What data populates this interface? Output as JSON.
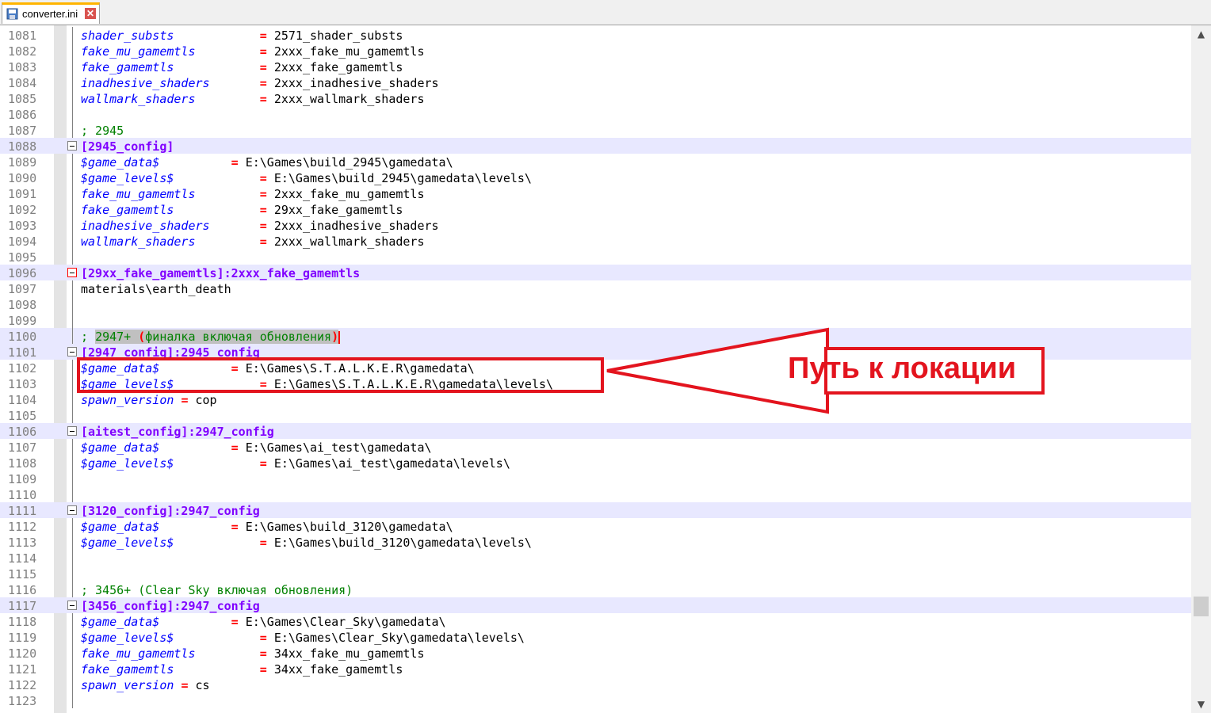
{
  "tab": {
    "title": "converter.ini",
    "icon": "save-icon",
    "close_icon": "close-icon"
  },
  "callout": {
    "text": "Путь к локации",
    "color": "#e3141e"
  },
  "lines": [
    {
      "n": "1081",
      "parts": [
        [
          "k",
          "shader_substs"
        ],
        [
          "p",
          "            "
        ],
        [
          "eq",
          "="
        ],
        [
          "p",
          " 2571_shader_substs"
        ]
      ]
    },
    {
      "n": "1082",
      "parts": [
        [
          "k",
          "fake_mu_gamemtls"
        ],
        [
          "p",
          "         "
        ],
        [
          "eq",
          "="
        ],
        [
          "p",
          " 2xxx_fake_mu_gamemtls"
        ]
      ]
    },
    {
      "n": "1083",
      "parts": [
        [
          "k",
          "fake_gamemtls"
        ],
        [
          "p",
          "            "
        ],
        [
          "eq",
          "="
        ],
        [
          "p",
          " 2xxx_fake_gamemtls"
        ]
      ]
    },
    {
      "n": "1084",
      "parts": [
        [
          "k",
          "inadhesive_shaders"
        ],
        [
          "p",
          "       "
        ],
        [
          "eq",
          "="
        ],
        [
          "p",
          " 2xxx_inadhesive_shaders"
        ]
      ]
    },
    {
      "n": "1085",
      "parts": [
        [
          "k",
          "wallmark_shaders"
        ],
        [
          "p",
          "         "
        ],
        [
          "eq",
          "="
        ],
        [
          "p",
          " 2xxx_wallmark_shaders"
        ]
      ]
    },
    {
      "n": "1086",
      "parts": []
    },
    {
      "n": "1087",
      "parts": [
        [
          "cm",
          "; 2945"
        ]
      ]
    },
    {
      "n": "1088",
      "parts": [
        [
          "sec",
          "[2945_config]"
        ]
      ],
      "hl": true
    },
    {
      "n": "1089",
      "parts": [
        [
          "k",
          "$game_data$"
        ],
        [
          "p",
          "          "
        ],
        [
          "eq",
          "="
        ],
        [
          "p",
          " E:\\Games\\build_2945\\gamedata\\"
        ]
      ]
    },
    {
      "n": "1090",
      "parts": [
        [
          "k",
          "$game_levels$"
        ],
        [
          "p",
          "            "
        ],
        [
          "eq",
          "="
        ],
        [
          "p",
          " E:\\Games\\build_2945\\gamedata\\levels\\"
        ]
      ]
    },
    {
      "n": "1091",
      "parts": [
        [
          "k",
          "fake_mu_gamemtls"
        ],
        [
          "p",
          "         "
        ],
        [
          "eq",
          "="
        ],
        [
          "p",
          " 2xxx_fake_mu_gamemtls"
        ]
      ]
    },
    {
      "n": "1092",
      "parts": [
        [
          "k",
          "fake_gamemtls"
        ],
        [
          "p",
          "            "
        ],
        [
          "eq",
          "="
        ],
        [
          "p",
          " 29xx_fake_gamemtls"
        ]
      ]
    },
    {
      "n": "1093",
      "parts": [
        [
          "k",
          "inadhesive_shaders"
        ],
        [
          "p",
          "       "
        ],
        [
          "eq",
          "="
        ],
        [
          "p",
          " 2xxx_inadhesive_shaders"
        ]
      ]
    },
    {
      "n": "1094",
      "parts": [
        [
          "k",
          "wallmark_shaders"
        ],
        [
          "p",
          "         "
        ],
        [
          "eq",
          "="
        ],
        [
          "p",
          " 2xxx_wallmark_shaders"
        ]
      ]
    },
    {
      "n": "1095",
      "parts": []
    },
    {
      "n": "1096",
      "parts": [
        [
          "sec",
          "[29xx_fake_gamemtls]:2xxx_fake_gamemtls"
        ]
      ],
      "hl": true
    },
    {
      "n": "1097",
      "parts": [
        [
          "p",
          "materials\\earth_death"
        ]
      ]
    },
    {
      "n": "1098",
      "parts": []
    },
    {
      "n": "1099",
      "parts": []
    },
    {
      "n": "1100",
      "parts": [
        [
          "cm",
          "; "
        ],
        [
          "cmsel",
          "2947+ "
        ],
        [
          "cmsel_red",
          "("
        ],
        [
          "cmsel",
          "финалка включая обновления"
        ],
        [
          "cmsel_red",
          ")"
        ],
        [
          "cursor",
          ""
        ]
      ],
      "hl": true
    },
    {
      "n": "1101",
      "parts": [
        [
          "sec",
          "[2947_config]:2945_config"
        ]
      ],
      "hl": true
    },
    {
      "n": "1102",
      "parts": [
        [
          "k",
          "$game_data$"
        ],
        [
          "p",
          "          "
        ],
        [
          "eq",
          "="
        ],
        [
          "p",
          " E:\\Games\\S.T.A.L.K.E.R\\gamedata\\"
        ]
      ]
    },
    {
      "n": "1103",
      "parts": [
        [
          "k",
          "$game_levels$"
        ],
        [
          "p",
          "            "
        ],
        [
          "eq",
          "="
        ],
        [
          "p",
          " E:\\Games\\S.T.A.L.K.E.R\\gamedata\\levels\\"
        ]
      ]
    },
    {
      "n": "1104",
      "parts": [
        [
          "k",
          "spawn_version"
        ],
        [
          "p",
          " "
        ],
        [
          "eq",
          "="
        ],
        [
          "p",
          " cop"
        ]
      ]
    },
    {
      "n": "1105",
      "parts": []
    },
    {
      "n": "1106",
      "parts": [
        [
          "sec",
          "[aitest_config]:2947_config"
        ]
      ],
      "hl": true
    },
    {
      "n": "1107",
      "parts": [
        [
          "k",
          "$game_data$"
        ],
        [
          "p",
          "          "
        ],
        [
          "eq",
          "="
        ],
        [
          "p",
          " E:\\Games\\ai_test\\gamedata\\"
        ]
      ]
    },
    {
      "n": "1108",
      "parts": [
        [
          "k",
          "$game_levels$"
        ],
        [
          "p",
          "            "
        ],
        [
          "eq",
          "="
        ],
        [
          "p",
          " E:\\Games\\ai_test\\gamedata\\levels\\"
        ]
      ]
    },
    {
      "n": "1109",
      "parts": []
    },
    {
      "n": "1110",
      "parts": []
    },
    {
      "n": "1111",
      "parts": [
        [
          "sec",
          "[3120_config]:2947_config"
        ]
      ],
      "hl": true
    },
    {
      "n": "1112",
      "parts": [
        [
          "k",
          "$game_data$"
        ],
        [
          "p",
          "          "
        ],
        [
          "eq",
          "="
        ],
        [
          "p",
          " E:\\Games\\build_3120\\gamedata\\"
        ]
      ]
    },
    {
      "n": "1113",
      "parts": [
        [
          "k",
          "$game_levels$"
        ],
        [
          "p",
          "            "
        ],
        [
          "eq",
          "="
        ],
        [
          "p",
          " E:\\Games\\build_3120\\gamedata\\levels\\"
        ]
      ]
    },
    {
      "n": "1114",
      "parts": []
    },
    {
      "n": "1115",
      "parts": []
    },
    {
      "n": "1116",
      "parts": [
        [
          "cm",
          "; 3456+ (Clear Sky включая обновления)"
        ]
      ]
    },
    {
      "n": "1117",
      "parts": [
        [
          "sec",
          "[3456_config]:2947_config"
        ]
      ],
      "hl": true
    },
    {
      "n": "1118",
      "parts": [
        [
          "k",
          "$game_data$"
        ],
        [
          "p",
          "          "
        ],
        [
          "eq",
          "="
        ],
        [
          "p",
          " E:\\Games\\Clear_Sky\\gamedata\\"
        ]
      ]
    },
    {
      "n": "1119",
      "parts": [
        [
          "k",
          "$game_levels$"
        ],
        [
          "p",
          "            "
        ],
        [
          "eq",
          "="
        ],
        [
          "p",
          " E:\\Games\\Clear_Sky\\gamedata\\levels\\"
        ]
      ]
    },
    {
      "n": "1120",
      "parts": [
        [
          "k",
          "fake_mu_gamemtls"
        ],
        [
          "p",
          "         "
        ],
        [
          "eq",
          "="
        ],
        [
          "p",
          " 34xx_fake_mu_gamemtls"
        ]
      ]
    },
    {
      "n": "1121",
      "parts": [
        [
          "k",
          "fake_gamemtls"
        ],
        [
          "p",
          "            "
        ],
        [
          "eq",
          "="
        ],
        [
          "p",
          " 34xx_fake_gamemtls"
        ]
      ]
    },
    {
      "n": "1122",
      "parts": [
        [
          "k",
          "spawn_version"
        ],
        [
          "p",
          " "
        ],
        [
          "eq",
          "="
        ],
        [
          "p",
          " cs"
        ]
      ]
    },
    {
      "n": "1123",
      "parts": []
    }
  ]
}
